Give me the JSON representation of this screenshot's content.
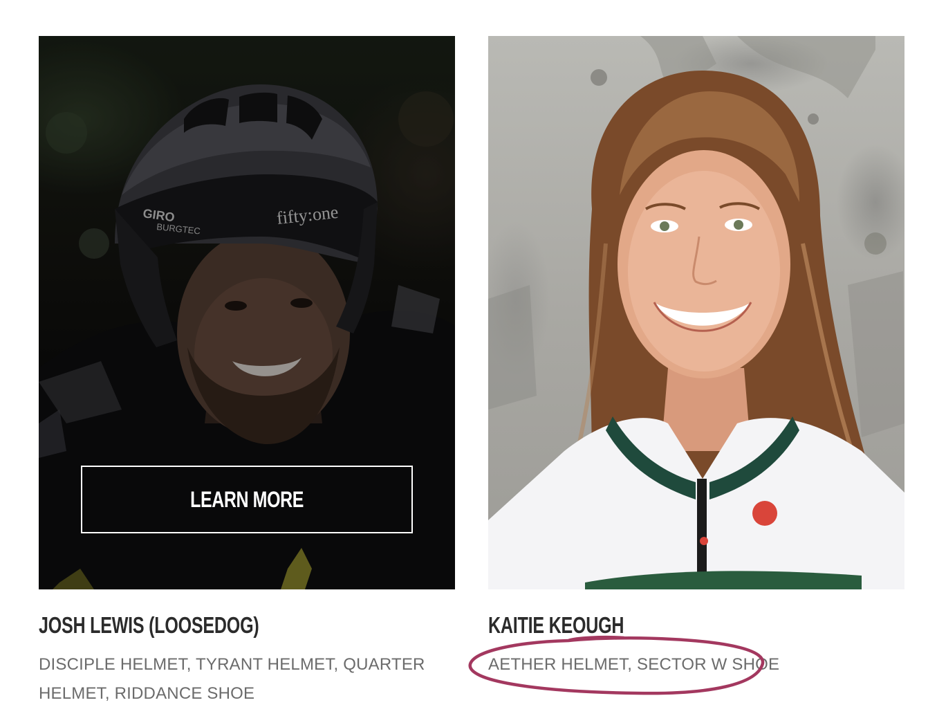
{
  "cards": [
    {
      "name": "JOSH LEWIS (LOOSEDOG)",
      "gear": "DISCIPLE HELMET, TYRANT HELMET, QUARTER HELMET, RIDDANCE SHOE",
      "button_label": "LEARN MORE",
      "helmet_brand_text": "GIRO",
      "helmet_sponsor_text": "fifty:one",
      "helmet_sponsor2_text": "BURGTEC"
    },
    {
      "name": "KAITIE KEOUGH",
      "gear": "AETHER HELMET, SECTOR W SHOE"
    }
  ],
  "colors": {
    "name_text": "#2b2b2b",
    "gear_text": "#6b6b6b",
    "annotation_stroke": "#a3385f"
  }
}
